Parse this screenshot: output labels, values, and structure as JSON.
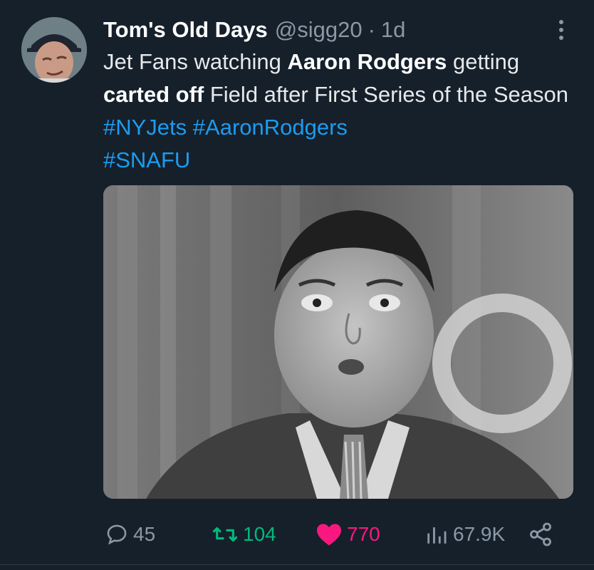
{
  "tweet": {
    "author_name": "Tom's Old Days",
    "handle": "@sigg20",
    "separator": "·",
    "time": "1d",
    "text_parts": [
      {
        "text": "Jet Fans watching ",
        "style": "normal"
      },
      {
        "text": "Aaron Rodgers",
        "style": "bold"
      },
      {
        "text": " getting ",
        "style": "normal"
      },
      {
        "text": "carted off",
        "style": "bold"
      },
      {
        "text": " Field after First Series of the Season ",
        "style": "normal"
      },
      {
        "text": "#NYJets",
        "style": "hashtag"
      },
      {
        "text": " ",
        "style": "normal"
      },
      {
        "text": "#AaronRodgers",
        "style": "hashtag"
      },
      {
        "text": " ",
        "style": "normal"
      },
      {
        "text": "#SNAFU",
        "style": "hashtag"
      }
    ]
  },
  "actions": {
    "replies": "45",
    "retweets": "104",
    "likes": "770",
    "views": "67.9K"
  },
  "icons": {
    "reply": "reply-icon",
    "retweet": "retweet-icon",
    "like": "heart-icon",
    "views": "views-icon",
    "share": "share-icon",
    "more": "more-icon"
  },
  "colors": {
    "background": "#15202b",
    "text": "#e7e9ea",
    "muted": "#8b98a5",
    "hashtag": "#1d9bf0",
    "retweet": "#00ba7c",
    "like": "#f91880"
  }
}
